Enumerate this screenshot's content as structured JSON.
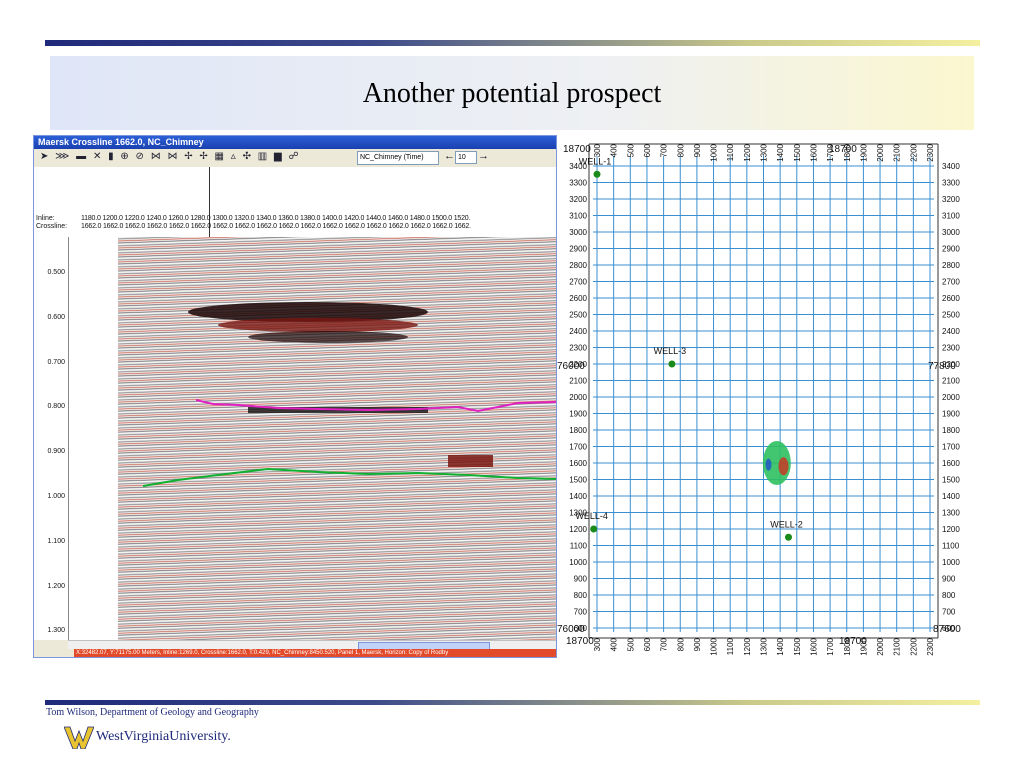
{
  "slide": {
    "title": "Another potential prospect",
    "footer": "Tom Wilson, Department of Geology and Geography",
    "logo_text": "WestVirginiaUniversity.",
    "colors": {
      "navy": "#1f2a7a",
      "gold": "#e8c430"
    }
  },
  "seismic_window": {
    "title": "Maersk Crossline 1662.0, NC_Chimney",
    "toolbar_icons": "➤ ⋙ ▬ ✕ ▮ ⊕ ⊘ ⋈ ⋈ ✢ ✢ ▦ ▵ ✣ ▥ ▆ ☍",
    "attribute_select": "NC_Chimney (Time)",
    "step_value": "10",
    "arrow_left": "←",
    "arrow_right": "→",
    "inline_label": "Inline:",
    "crossline_label": "Crossline:",
    "inline_ticks": "1180.0  1200.0  1220.0  1240.0  1260.0  1280.0  1300.0  1320.0  1340.0  1360.0  1380.0  1400.0  1420.0  1440.0  1460.0  1480.0  1500.0  1520.",
    "crossline_ticks": "1662.0  1662.0  1662.0  1662.0  1662.0  1662.0  1662.0  1662.0  1662.0  1662.0  1662.0  1662.0  1662.0  1662.0  1662.0  1662.0  1662.0  1662.",
    "time_labels": [
      "0.500",
      "0.600",
      "0.700",
      "0.800",
      "0.900",
      "1.000",
      "1.100",
      "1.200",
      "1.300"
    ],
    "status_text": "X:32482.07, Y:71175.00 Meters,  Inline:1269.0,  Crossline:1662.0,  T:0.429,  NC_Chimney:8450.520,  Panel 1,  Maersk,  Horizon: Copy of Rodby",
    "horizon_colors": {
      "upper": "#e020c0",
      "lower": "#10b030"
    }
  },
  "map": {
    "x_ticks": [
      "300",
      "400",
      "500",
      "600",
      "700",
      "800",
      "900",
      "1000",
      "1100",
      "1200",
      "1300",
      "1400",
      "1500",
      "1600",
      "1700",
      "1800",
      "1900",
      "2000",
      "2100",
      "2200",
      "2300"
    ],
    "y_ticks": [
      "3400",
      "3300",
      "3200",
      "3100",
      "3000",
      "2900",
      "2800",
      "2700",
      "2600",
      "2500",
      "2400",
      "2300",
      "2200",
      "2100",
      "2000",
      "1900",
      "1800",
      "1700",
      "1600",
      "1500",
      "1400",
      "1300",
      "1200",
      "1100",
      "1000",
      "900",
      "800",
      "700",
      "600"
    ],
    "corner_tl": "18700",
    "corner_bl": "18700",
    "top_mid": "18700",
    "bottom_mid": "18700",
    "left_mid": "76000",
    "right_mid": "77800",
    "left_bottom": "76000",
    "right_bottom": "87600",
    "wells": [
      {
        "label": "WELL-1",
        "x": 300,
        "y": 3350
      },
      {
        "label": "WELL-3",
        "x": 750,
        "y": 2200
      },
      {
        "label": "WELL-4",
        "x": 280,
        "y": 1200
      },
      {
        "label": "WELL-2",
        "x": 1450,
        "y": 1150
      }
    ],
    "grid_color": "#3a8fd0",
    "well_color": "#1a8a1a"
  }
}
